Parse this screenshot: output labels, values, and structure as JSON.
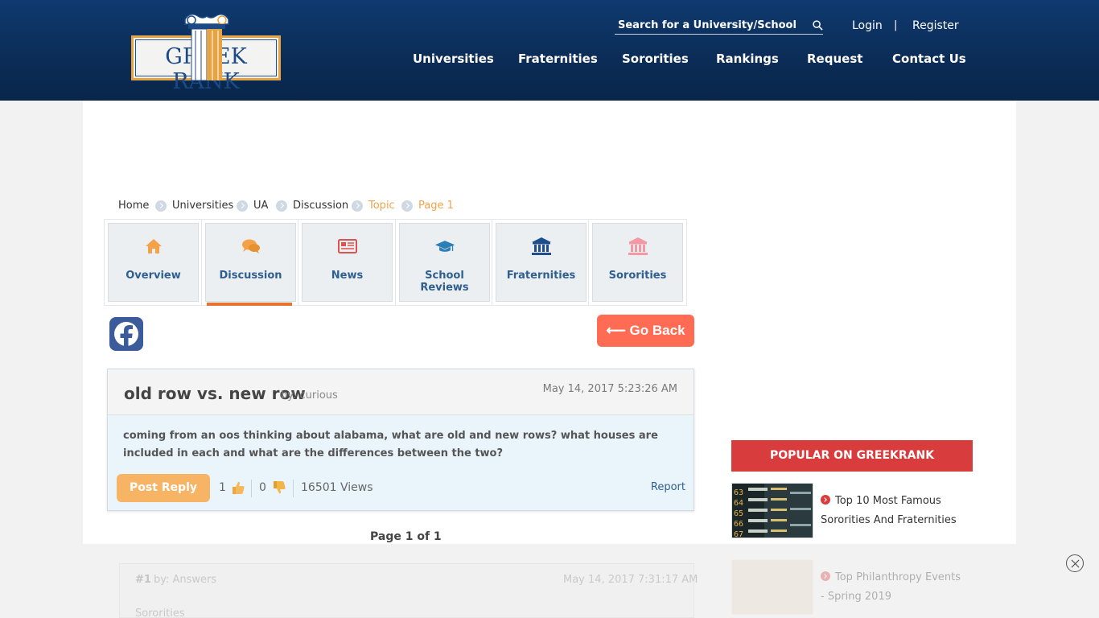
{
  "header": {
    "logo_text": "GREEK RANK",
    "search": {
      "placeholder": "Search for a University/School"
    },
    "login": "Login",
    "separator": "|",
    "register": "Register",
    "nav": [
      "Universities",
      "Fraternities",
      "Sororities",
      "Rankings",
      "Request",
      "Contact Us"
    ]
  },
  "breadcrumb": [
    "Home",
    "Universities",
    "UA",
    "Discussion",
    "Topic",
    "Page 1"
  ],
  "tabs": [
    {
      "label": "Overview",
      "icon": "home-icon",
      "color": "#f4a24a"
    },
    {
      "label": "Discussion",
      "icon": "chat-icon",
      "color": "#f4a24a"
    },
    {
      "label": "News",
      "icon": "newspaper-icon",
      "color": "#d9534f"
    },
    {
      "label": "School Reviews",
      "icon": "graduation-cap-icon",
      "color": "#2a7fb8"
    },
    {
      "label": "Fraternities",
      "icon": "bank-icon",
      "color": "#1f4e8c"
    },
    {
      "label": "Sororities",
      "icon": "bank-icon",
      "color": "#f19aa6"
    }
  ],
  "go_back": "⟵ Go Back",
  "topic": {
    "title": "old row vs. new row",
    "by": "by: curious",
    "date": "May 14, 2017 5:23:26 AM",
    "body": "coming from an oos thinking about alabama, what are old and new rows? what houses are included in each and what are the differences between the two?",
    "reply_label": "Post Reply",
    "likes": "1",
    "dislikes": "0",
    "views": "16501 Views",
    "report": "Report"
  },
  "pagination": "Page 1 of 1",
  "sidebar": {
    "popular_header": "POPULAR ON GREEKRANK",
    "items": [
      {
        "title": "Top 10 Most Famous Sororities And Fraternities"
      },
      {
        "title": "Top Philanthropy Events - Spring 2019"
      }
    ],
    "thumb_numbers": [
      "63",
      "64",
      "65",
      "66",
      "67"
    ]
  },
  "answer": {
    "number": "#1",
    "by": "by: Answers",
    "date": "May 14, 2017 7:31:17 AM",
    "body": "Sororities"
  }
}
